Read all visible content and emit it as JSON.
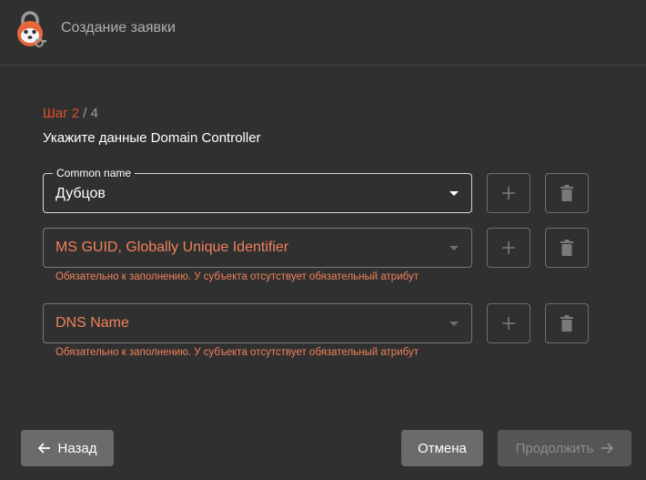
{
  "header": {
    "title": "Создание заявки"
  },
  "step": {
    "current": "Шаг 2",
    "separator": " / ",
    "total": "4"
  },
  "subtitle": "Укажите данные Domain Controller",
  "fields": [
    {
      "label": "Common name",
      "value": "Дубцов",
      "placeholder": "",
      "error": ""
    },
    {
      "label": "",
      "value": "",
      "placeholder": "MS GUID, Globally Unique Identifier",
      "error": "Обязательно к заполнению. У субъекта отсутствует обязательный атрибут"
    },
    {
      "label": "",
      "value": "",
      "placeholder": "DNS Name",
      "error": "Обязательно к заполнению. У субъекта отсутствует обязательный атрибут"
    }
  ],
  "buttons": {
    "back": "Назад",
    "cancel": "Отмена",
    "next": "Продолжить"
  },
  "colors": {
    "background": "#303030",
    "accent": "#e0502a",
    "error": "#f0815a",
    "button": "#6b6b6b"
  },
  "icons": [
    "app-logo-icon",
    "chevron-down-icon",
    "plus-icon",
    "trash-icon",
    "arrow-left-icon",
    "arrow-right-icon"
  ]
}
